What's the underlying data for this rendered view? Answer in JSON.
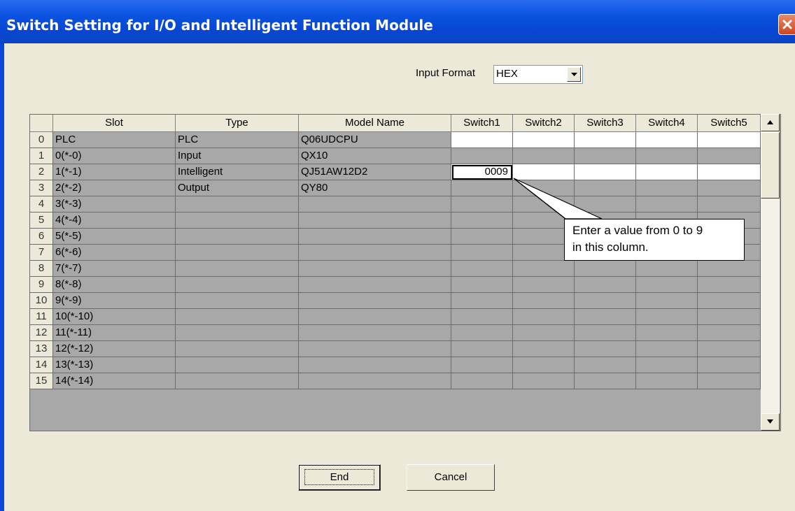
{
  "window": {
    "title": "Switch Setting for I/O and Intelligent Function Module"
  },
  "input_format": {
    "label": "Input Format",
    "value": "HEX"
  },
  "grid": {
    "headers": [
      "",
      "Slot",
      "Type",
      "Model Name",
      "Switch1",
      "Switch2",
      "Switch3",
      "Switch4",
      "Switch5"
    ],
    "rows": [
      {
        "num": "0",
        "slot": "PLC",
        "type": "PLC",
        "model": "Q06UDCPU",
        "switches": [
          "",
          "",
          "",
          "",
          ""
        ]
      },
      {
        "num": "1",
        "slot": "0(*-0)",
        "type": "Input",
        "model": "QX10",
        "switches": [
          "",
          "",
          "",
          "",
          ""
        ]
      },
      {
        "num": "2",
        "slot": "1(*-1)",
        "type": "Intelligent",
        "model": "QJ51AW12D2",
        "switches": [
          "0009",
          "",
          "",
          "",
          ""
        ]
      },
      {
        "num": "3",
        "slot": "2(*-2)",
        "type": "Output",
        "model": "QY80",
        "switches": [
          "",
          "",
          "",
          "",
          ""
        ]
      },
      {
        "num": "4",
        "slot": "3(*-3)",
        "type": "",
        "model": "",
        "switches": [
          "",
          "",
          "",
          "",
          ""
        ]
      },
      {
        "num": "5",
        "slot": "4(*-4)",
        "type": "",
        "model": "",
        "switches": [
          "",
          "",
          "",
          "",
          ""
        ]
      },
      {
        "num": "6",
        "slot": "5(*-5)",
        "type": "",
        "model": "",
        "switches": [
          "",
          "",
          "",
          "",
          ""
        ]
      },
      {
        "num": "7",
        "slot": "6(*-6)",
        "type": "",
        "model": "",
        "switches": [
          "",
          "",
          "",
          "",
          ""
        ]
      },
      {
        "num": "8",
        "slot": "7(*-7)",
        "type": "",
        "model": "",
        "switches": [
          "",
          "",
          "",
          "",
          ""
        ]
      },
      {
        "num": "9",
        "slot": "8(*-8)",
        "type": "",
        "model": "",
        "switches": [
          "",
          "",
          "",
          "",
          ""
        ]
      },
      {
        "num": "10",
        "slot": "9(*-9)",
        "type": "",
        "model": "",
        "switches": [
          "",
          "",
          "",
          "",
          ""
        ]
      },
      {
        "num": "11",
        "slot": "10(*-10)",
        "type": "",
        "model": "",
        "switches": [
          "",
          "",
          "",
          "",
          ""
        ]
      },
      {
        "num": "12",
        "slot": "11(*-11)",
        "type": "",
        "model": "",
        "switches": [
          "",
          "",
          "",
          "",
          ""
        ]
      },
      {
        "num": "13",
        "slot": "12(*-12)",
        "type": "",
        "model": "",
        "switches": [
          "",
          "",
          "",
          "",
          ""
        ]
      },
      {
        "num": "14",
        "slot": "13(*-13)",
        "type": "",
        "model": "",
        "switches": [
          "",
          "",
          "",
          "",
          ""
        ]
      },
      {
        "num": "15",
        "slot": "14(*-14)",
        "type": "",
        "model": "",
        "switches": [
          "",
          "",
          "",
          "",
          ""
        ]
      }
    ]
  },
  "callout": {
    "line1": "Enter a value from 0 to 9",
    "line2": "in this column."
  },
  "buttons": {
    "end": "End",
    "cancel": "Cancel"
  },
  "colors": {
    "title_bar": "#0b53e0",
    "dialog_bg": "#ece9d8",
    "disabled_cell": "#a8a8a8",
    "editable_cell": "#ffffff"
  },
  "icons": {
    "close": "close-icon",
    "dropdown": "chevron-down-icon",
    "scroll_up": "arrow-up-icon",
    "scroll_down": "arrow-down-icon"
  }
}
